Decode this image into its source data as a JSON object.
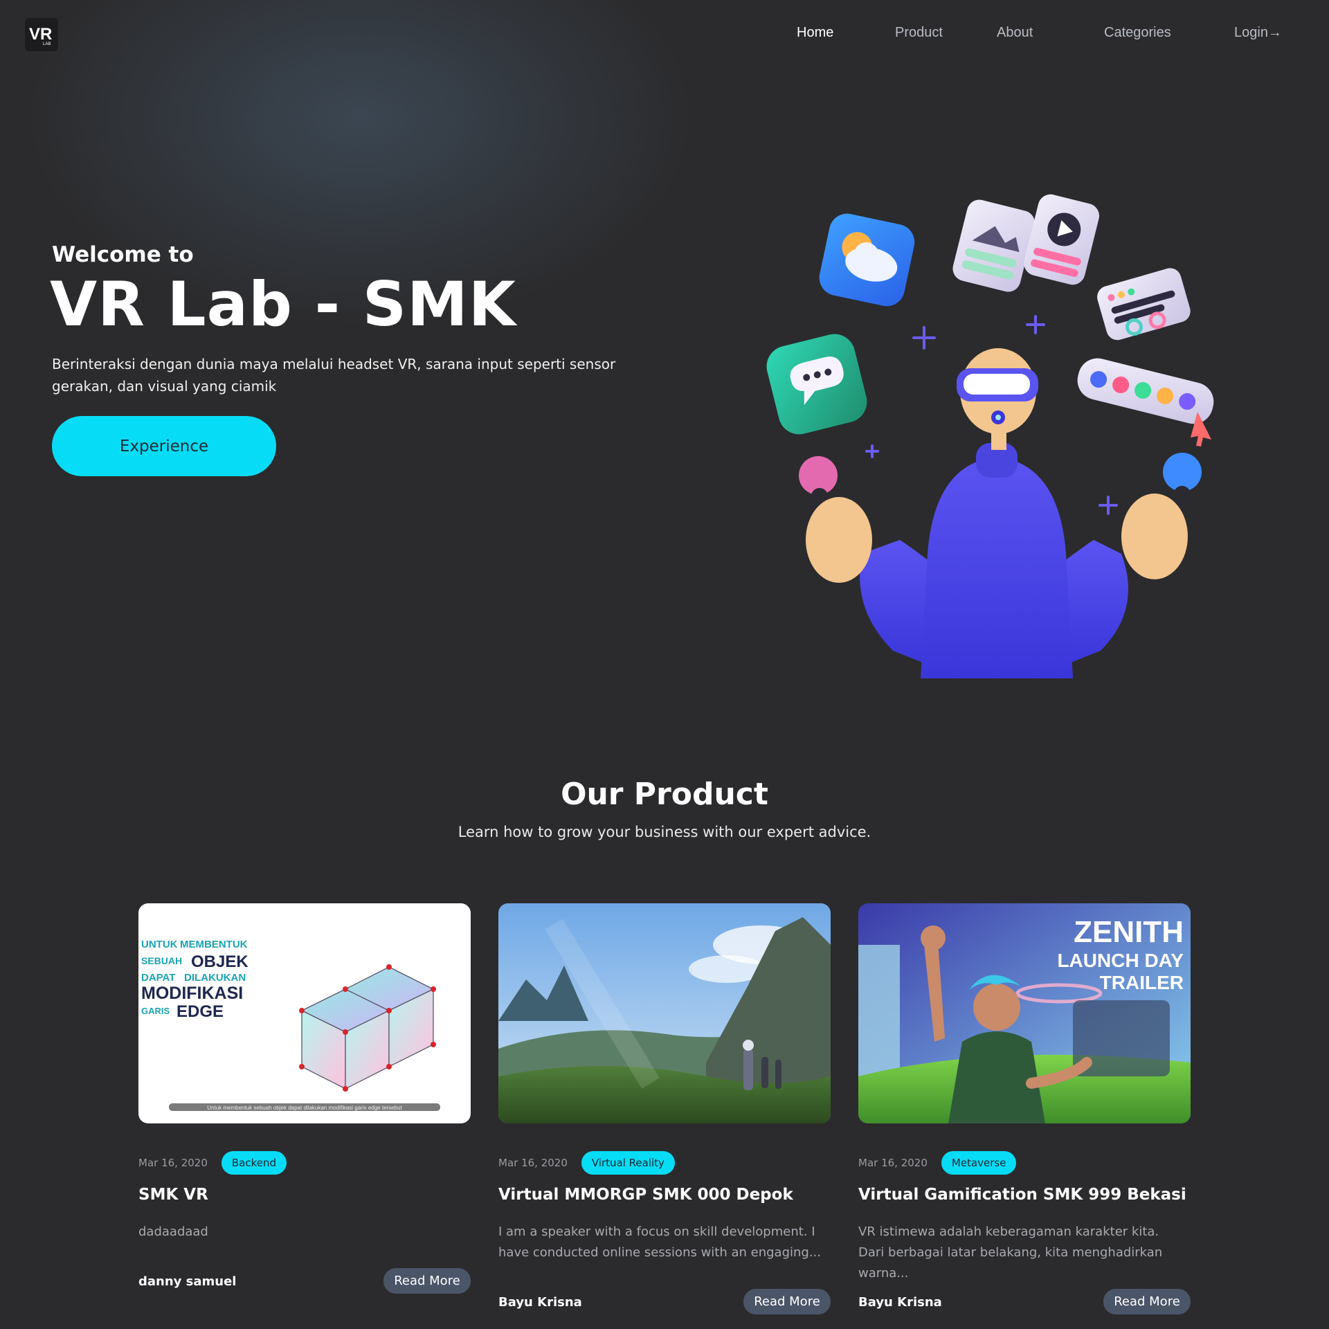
{
  "brand": {
    "logo_text": "VR",
    "logo_sub": "LAB"
  },
  "nav": {
    "items": [
      {
        "label": "Home",
        "active": true
      },
      {
        "label": "Product"
      },
      {
        "label": "About"
      },
      {
        "label": "Categories"
      },
      {
        "label": "Login→"
      }
    ]
  },
  "hero": {
    "welcome": "Welcome to",
    "title": "VR Lab - SMK",
    "description": "Berinteraksi dengan dunia maya melalui headset VR, sarana input seperti sensor gerakan, dan visual yang ciamik",
    "cta_label": "Experience"
  },
  "products": {
    "title": "Our Product",
    "subtitle": "Learn how to grow your business with our expert advice.",
    "cards": [
      {
        "date": "Mar 16, 2020",
        "tag": "Backend",
        "title": "SMK VR",
        "description": "dadaadaad",
        "author": "danny samuel",
        "read_more": "Read More",
        "thumb_text": {
          "line1a": "UNTUK",
          "line1b": "MEMBENTUK",
          "line2a": "SEBUAH",
          "line2b": "OBJEK",
          "line3a": "DAPAT",
          "line3b": "DILAKUKAN",
          "line4": "MODIFIKASI",
          "line5a": "GARIS",
          "line5b": "EDGE",
          "caption": "Untuk membentuk sebuah objek dapat dilakukan modifikasi garis edge tersebut"
        }
      },
      {
        "date": "Mar 16, 2020",
        "tag": "Virtual Reality",
        "title": "Virtual MMORGP SMK 000 Depok",
        "description": "I am a speaker with a focus on skill development. I have conducted online sessions with an engaging...",
        "author": "Bayu Krisna",
        "read_more": "Read More"
      },
      {
        "date": "Mar 16, 2020",
        "tag": "Metaverse",
        "title": "Virtual Gamification SMK 999 Bekasi",
        "description": "VR istimewa adalah keberagaman karakter kita. Dari berbagai latar belakang, kita menghadirkan warna...",
        "author": "Bayu Krisna",
        "read_more": "Read More",
        "thumb_text": {
          "line1": "ZENITH",
          "line2": "LAUNCH DAY",
          "line3": "TRAILER"
        }
      }
    ]
  },
  "colors": {
    "background": "#2b2b2d",
    "accent": "#06dcf5",
    "button_dark": "#4b5568"
  }
}
